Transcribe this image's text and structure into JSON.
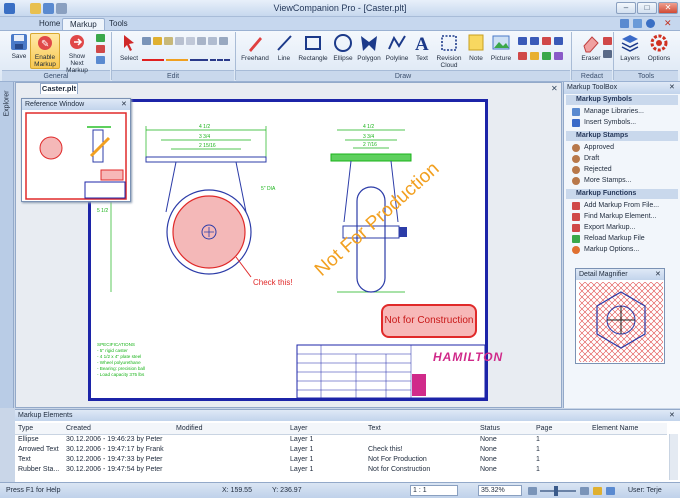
{
  "app": {
    "title": "ViewCompanion Pro - [Caster.plt]"
  },
  "window_controls": {
    "minimize": "–",
    "maximize": "□",
    "close": "✕"
  },
  "tabs": [
    {
      "label": "Home"
    },
    {
      "label": "Markup"
    },
    {
      "label": "Tools"
    }
  ],
  "ribbon": {
    "groups": {
      "general": "General",
      "edit": "Edit",
      "draw": "Draw",
      "redact": "Redact",
      "tools": "Tools"
    },
    "general": {
      "save": "Save",
      "enable_markup": "Enable Markup",
      "show_next_markup": "Show Next Markup"
    },
    "edit": {
      "select": "Select"
    },
    "draw": {
      "freehand": "Freehand",
      "line": "Line",
      "rectangle": "Rectangle",
      "ellipse": "Ellipse",
      "polygon": "Polygon",
      "polyline": "Polyline",
      "text": "Text",
      "revision_cloud": "Revision Cloud",
      "note": "Note",
      "picture": "Picture"
    },
    "redact": {
      "eraser": "Eraser"
    },
    "tools": {
      "layers": "Layers",
      "options": "Options"
    }
  },
  "explorer": {
    "label": "Explorer"
  },
  "document": {
    "tab": "Caster.plt",
    "markups": {
      "not_for_production": "Not For Production",
      "check_this": "Check this!",
      "not_for_construction": "Not for Construction"
    },
    "title_block": {
      "company": "HAMILTON"
    }
  },
  "reference_window": {
    "title": "Reference Window"
  },
  "toolbox": {
    "title": "Markup ToolBox",
    "sections": [
      {
        "title": "Markup Symbols",
        "items": [
          "Manage Libraries...",
          "Insert Symbols..."
        ]
      },
      {
        "title": "Markup Stamps",
        "items": [
          "Approved",
          "Draft",
          "Rejected",
          "More Stamps..."
        ]
      },
      {
        "title": "Markup Functions",
        "items": [
          "Add Markup From File...",
          "Find Markup Element...",
          "Export Markup...",
          "Reload Markup File",
          "Markup Options..."
        ]
      }
    ],
    "magnifier_title": "Detail Magnifier"
  },
  "markup_elements": {
    "title": "Markup Elements",
    "columns": [
      "Type",
      "Created",
      "Modified",
      "Layer",
      "Text",
      "Status",
      "Page",
      "Element Name"
    ],
    "rows": [
      [
        "Ellipse",
        "30.12.2006 - 19:46:23 by Peter",
        "",
        "Layer 1",
        "",
        "None",
        "1",
        ""
      ],
      [
        "Arrowed Text",
        "30.12.2006 - 19:47:17 by Frank",
        "",
        "Layer 1",
        "Check this!",
        "None",
        "1",
        ""
      ],
      [
        "Text",
        "30.12.2006 - 19:47:33 by Peter",
        "",
        "Layer 1",
        "Not For Production",
        "None",
        "1",
        ""
      ],
      [
        "Rubber Sta...",
        "30.12.2006 - 19:47:54 by Peter",
        "",
        "Layer 1",
        "Not for Construction",
        "None",
        "1",
        ""
      ]
    ]
  },
  "status": {
    "help": "Press F1 for Help",
    "x": "X: 159.55",
    "y": "Y: 236.97",
    "scale": "1 : 1",
    "zoom": "35.32%",
    "user": "User: Terje"
  },
  "colors": {
    "accent": "#1c24a8",
    "markup_red": "#e0202a",
    "markup_orange": "#f2a020",
    "cad_green": "#19b319"
  }
}
